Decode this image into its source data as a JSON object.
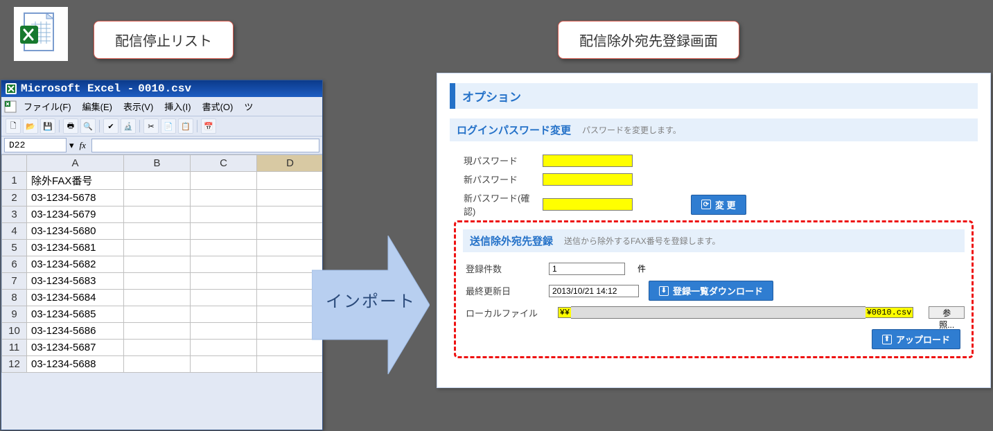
{
  "callouts": {
    "left": "配信停止リスト",
    "right": "配信除外宛先登録画面"
  },
  "excel": {
    "title_prefix": "Microsoft Excel - ",
    "filename": "0010.csv",
    "menus": [
      "ファイル(F)",
      "編集(E)",
      "表示(V)",
      "挿入(I)",
      "書式(O)",
      "ツ"
    ],
    "namebox": "D22",
    "fx": "fx",
    "columns": [
      "A",
      "B",
      "C",
      "D"
    ],
    "rows": [
      {
        "n": "1",
        "a": "除外FAX番号"
      },
      {
        "n": "2",
        "a": "03-1234-5678"
      },
      {
        "n": "3",
        "a": "03-1234-5679"
      },
      {
        "n": "4",
        "a": "03-1234-5680"
      },
      {
        "n": "5",
        "a": "03-1234-5681"
      },
      {
        "n": "6",
        "a": "03-1234-5682"
      },
      {
        "n": "7",
        "a": "03-1234-5683"
      },
      {
        "n": "8",
        "a": "03-1234-5684"
      },
      {
        "n": "9",
        "a": "03-1234-5685"
      },
      {
        "n": "10",
        "a": "03-1234-5686"
      },
      {
        "n": "11",
        "a": "03-1234-5687"
      },
      {
        "n": "12",
        "a": "03-1234-5688"
      }
    ]
  },
  "import_label": "インポート",
  "web": {
    "options_title": "オプション",
    "pw_section": {
      "title": "ログインパスワード変更",
      "desc": "パスワードを変更します。",
      "fields": {
        "current": "現パスワード",
        "new": "新パスワード",
        "confirm": "新パスワード(確認)"
      },
      "change_btn": "変 更"
    },
    "exclude_section": {
      "title": "送信除外宛先登録",
      "desc": "送信から除外するFAX番号を登録します。",
      "count_label": "登録件数",
      "count_value": "1",
      "count_unit": "件",
      "updated_label": "最終更新日",
      "updated_value": "2013/10/21 14:12",
      "download_btn": "登録一覧ダウンロード",
      "localfile_label": "ローカルファイル",
      "path_pre": "¥¥",
      "path_post": "¥0010.csv",
      "browse": "参照...",
      "upload_btn": "アップロード"
    }
  }
}
